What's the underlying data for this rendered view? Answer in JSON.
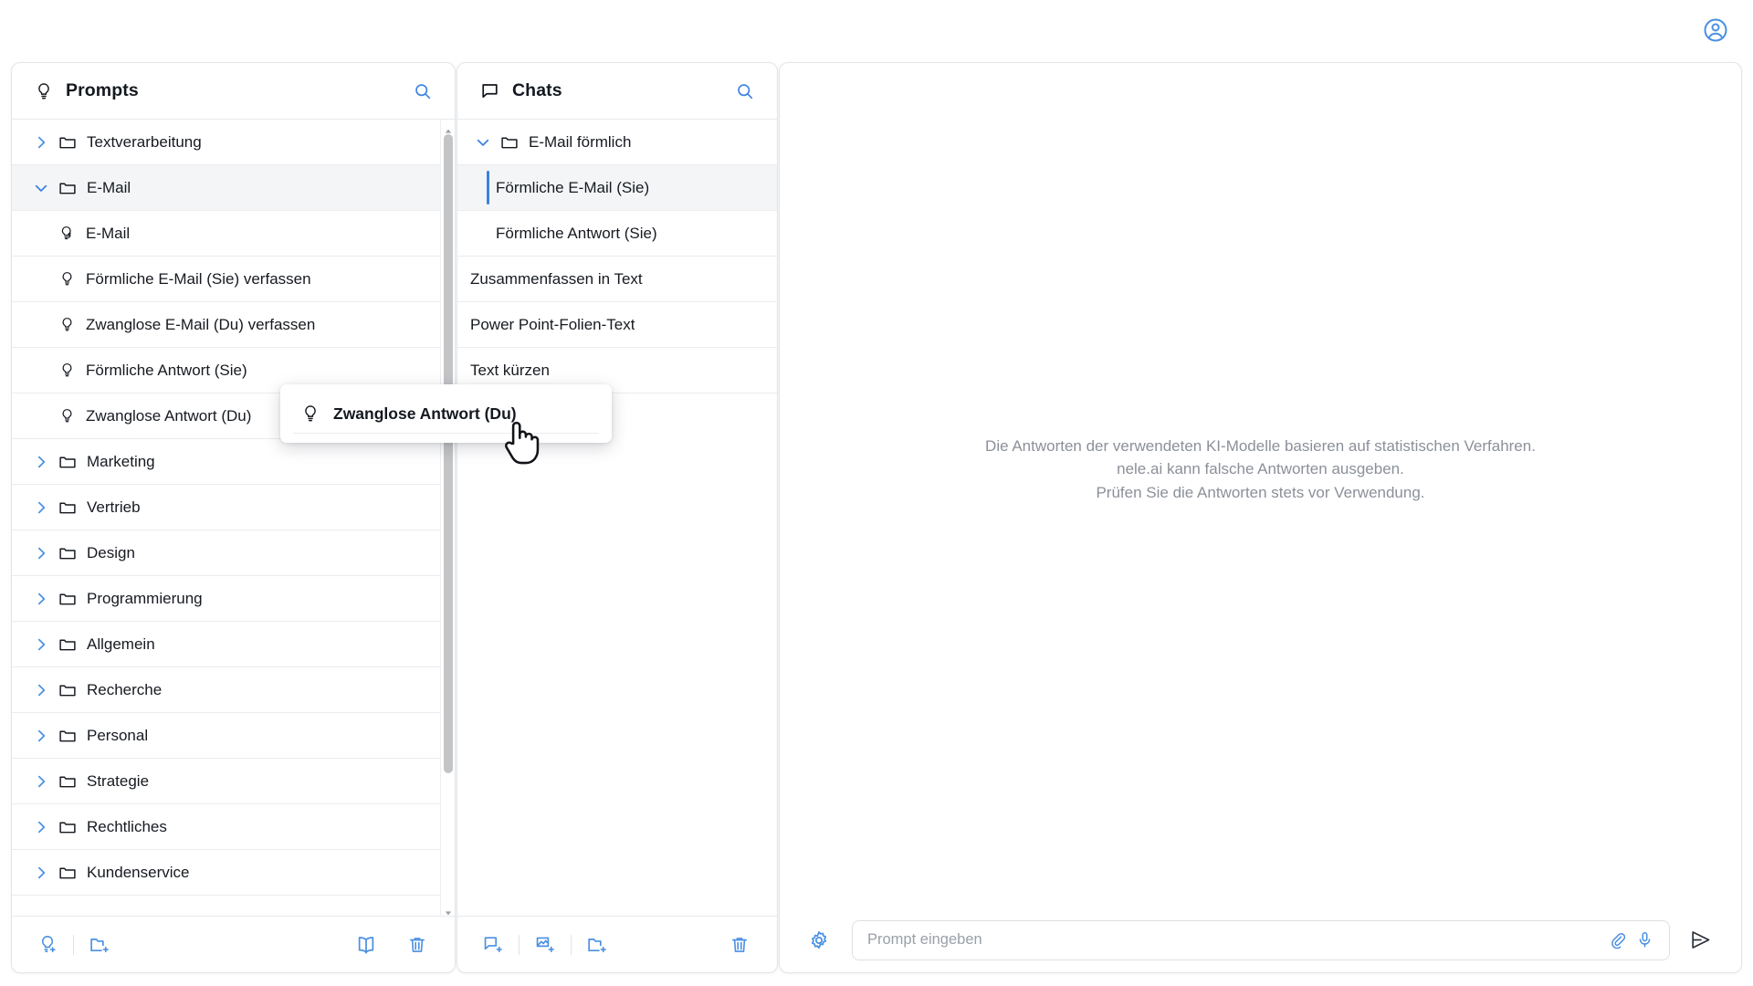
{
  "topbar": {
    "account_icon": "user-circle-icon"
  },
  "prompts_panel": {
    "title": "Prompts",
    "title_icon": "lightbulb-icon",
    "search_icon": "search-icon",
    "items": [
      {
        "label": "Textverarbeitung",
        "kind": "folder",
        "expanded": false,
        "level": 0,
        "selected": false
      },
      {
        "label": "E-Mail",
        "kind": "folder",
        "expanded": true,
        "level": 0,
        "selected": true
      },
      {
        "label": "E-Mail",
        "kind": "prompt-quick",
        "level": 1,
        "selected": false
      },
      {
        "label": "Förmliche E-Mail (Sie) verfassen",
        "kind": "prompt",
        "level": 1,
        "selected": false
      },
      {
        "label": "Zwanglose E-Mail (Du) verfassen",
        "kind": "prompt",
        "level": 1,
        "selected": false
      },
      {
        "label": "Förmliche Antwort (Sie)",
        "kind": "prompt",
        "level": 1,
        "selected": false
      },
      {
        "label": "Zwanglose Antwort (Du)",
        "kind": "prompt",
        "level": 1,
        "selected": false
      },
      {
        "label": "Marketing",
        "kind": "folder",
        "expanded": false,
        "level": 0,
        "selected": false
      },
      {
        "label": "Vertrieb",
        "kind": "folder",
        "expanded": false,
        "level": 0,
        "selected": false
      },
      {
        "label": "Design",
        "kind": "folder",
        "expanded": false,
        "level": 0,
        "selected": false
      },
      {
        "label": "Programmierung",
        "kind": "folder",
        "expanded": false,
        "level": 0,
        "selected": false
      },
      {
        "label": "Allgemein",
        "kind": "folder",
        "expanded": false,
        "level": 0,
        "selected": false
      },
      {
        "label": "Recherche",
        "kind": "folder",
        "expanded": false,
        "level": 0,
        "selected": false
      },
      {
        "label": "Personal",
        "kind": "folder",
        "expanded": false,
        "level": 0,
        "selected": false
      },
      {
        "label": "Strategie",
        "kind": "folder",
        "expanded": false,
        "level": 0,
        "selected": false
      },
      {
        "label": "Rechtliches",
        "kind": "folder",
        "expanded": false,
        "level": 0,
        "selected": false
      },
      {
        "label": "Kundenservice",
        "kind": "folder",
        "expanded": false,
        "level": 0,
        "selected": false
      }
    ],
    "toolbar": [
      {
        "name": "add-prompt-button",
        "icon": "lightbulb-plus-icon"
      },
      {
        "name": "divider",
        "icon": "divider"
      },
      {
        "name": "add-folder-button",
        "icon": "folder-plus-icon"
      },
      {
        "name": "prompt-library-button",
        "icon": "book-icon"
      },
      {
        "name": "delete-button",
        "icon": "trash-icon"
      }
    ]
  },
  "chats_panel": {
    "title": "Chats",
    "title_icon": "chat-bubble-icon",
    "search_icon": "search-icon",
    "items": [
      {
        "label": "E-Mail förmlich",
        "kind": "folder",
        "expanded": true,
        "level": 0,
        "selected": false
      },
      {
        "label": "Förmliche E-Mail (Sie)",
        "kind": "chat",
        "level": 1,
        "selected": true
      },
      {
        "label": "Förmliche Antwort (Sie)",
        "kind": "chat",
        "level": 1,
        "selected": false
      },
      {
        "label": "Zusammenfassen in Text",
        "kind": "chat",
        "level": 0,
        "selected": false
      },
      {
        "label": "Power Point-Folien-Text",
        "kind": "chat",
        "level": 0,
        "selected": false
      },
      {
        "label": "Text kürzen",
        "kind": "chat",
        "level": 0,
        "selected": false
      }
    ],
    "toolbar": [
      {
        "name": "new-chat-button",
        "icon": "chat-plus-icon"
      },
      {
        "name": "divider",
        "icon": "divider"
      },
      {
        "name": "new-image-chat-button",
        "icon": "image-plus-icon"
      },
      {
        "name": "divider",
        "icon": "divider"
      },
      {
        "name": "new-folder-button",
        "icon": "folder-plus-icon"
      },
      {
        "name": "delete-button",
        "icon": "trash-icon"
      }
    ]
  },
  "main_panel": {
    "disclaimer_line1": "Die Antworten der verwendeten KI-Modelle basieren auf statistischen Verfahren.",
    "disclaimer_line2": "nele.ai kann falsche Antworten ausgeben.",
    "disclaimer_line3": "Prüfen Sie die Antworten stets vor Verwendung.",
    "composer": {
      "settings_icon": "gear-icon",
      "placeholder": "Prompt eingeben",
      "value": "",
      "attach_icon": "paperclip-icon",
      "mic_icon": "microphone-icon",
      "send_icon": "send-icon"
    }
  },
  "drag_ghost": {
    "label": "Zwanglose Antwort (Du)",
    "icon": "lightbulb-icon",
    "cursor": "pointer-hand-cursor"
  },
  "colors": {
    "accent": "#3b82e0",
    "icon_blue": "#4a90e2",
    "text": "#161a20",
    "muted": "#8b9099",
    "border": "#e7eaee"
  }
}
